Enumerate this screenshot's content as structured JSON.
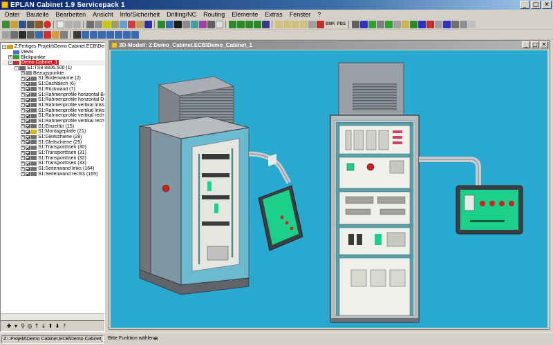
{
  "window": {
    "title": "EPLAN Cabinet 1.9 Servicepack 1",
    "min": "_",
    "max": "□",
    "close": "✕"
  },
  "menu": [
    "Datei",
    "Bauteile",
    "Bearbeiten",
    "Ansicht",
    "Info/Sicherheit",
    "Drilling/NC",
    "Routing",
    "Elemente",
    "Extras",
    "Fenster",
    "?"
  ],
  "toolbar": {
    "bmk_label": "BMK",
    "pbs_label": "PBS"
  },
  "tree": {
    "items": [
      {
        "indent": 0,
        "exp": "-",
        "label": "Z:Fertiges Projekt\\Demo Cabinet.ECB\\Demo_Cabinet_1",
        "icon": "project-icon",
        "color": "#d8a000"
      },
      {
        "indent": 1,
        "exp": "",
        "label": "Views",
        "icon": "views-icon",
        "color": "#5070c0"
      },
      {
        "indent": 1,
        "exp": "+",
        "label": "Blickpunkte",
        "icon": "viewpoint-icon",
        "color": "#30a030"
      },
      {
        "indent": 1,
        "exp": "-",
        "label": "Demo Cabinet_1",
        "icon": "cabinet-icon",
        "color": "#c03030",
        "selected": true
      },
      {
        "indent": 2,
        "exp": "-",
        "label": "S1:TS8 8806.500 (1)",
        "icon": "enclosure-icon",
        "color": "#606060"
      },
      {
        "indent": 3,
        "exp": "+",
        "label": "Bezugspunkte",
        "icon": "refpoint-icon",
        "color": "#909090",
        "nocheck": true
      },
      {
        "indent": 3,
        "exp": "+",
        "label": "S1:Bodenwanne (2)",
        "icon": "part-icon",
        "color": "#707070"
      },
      {
        "indent": 3,
        "exp": "+",
        "label": "S1:Dachblech (6)",
        "icon": "part-icon",
        "color": "#707070"
      },
      {
        "indent": 3,
        "exp": "+",
        "label": "S1:Rückwand (7)",
        "icon": "part-icon",
        "color": "#707070"
      },
      {
        "indent": 3,
        "exp": "+",
        "label": "S1:Rahmenprofile horizontal Bod",
        "icon": "profile-icon",
        "color": "#707070"
      },
      {
        "indent": 3,
        "exp": "+",
        "label": "S1:Rahmenprofile horizontal Dac",
        "icon": "profile-icon",
        "color": "#707070"
      },
      {
        "indent": 3,
        "exp": "+",
        "label": "S1:Rahmenprofile vertikal links v",
        "icon": "profile-icon",
        "color": "#707070"
      },
      {
        "indent": 3,
        "exp": "+",
        "label": "S1:Rahmenprofile vertikal links h",
        "icon": "profile-icon",
        "color": "#707070"
      },
      {
        "indent": 3,
        "exp": "+",
        "label": "S1:Rahmenprofile vertikal rechts",
        "icon": "profile-icon",
        "color": "#707070"
      },
      {
        "indent": 3,
        "exp": "+",
        "label": "S1:Rahmenprofile vertikal rechts",
        "icon": "profile-icon",
        "color": "#707070"
      },
      {
        "indent": 3,
        "exp": "+",
        "label": "S1:Einzeltür (15)",
        "icon": "door-icon",
        "color": "#707070"
      },
      {
        "indent": 3,
        "exp": "+",
        "label": "S1:Montageplatte (21)",
        "icon": "plate-icon",
        "color": "#e0b000"
      },
      {
        "indent": 3,
        "exp": "+",
        "label": "S1:Gleitschiene (28)",
        "icon": "rail-icon",
        "color": "#707070"
      },
      {
        "indent": 3,
        "exp": "+",
        "label": "S1:Gleitschiene (29)",
        "icon": "rail-icon",
        "color": "#707070"
      },
      {
        "indent": 3,
        "exp": "+",
        "label": "S1:Transportösen (30)",
        "icon": "eyelet-icon",
        "color": "#707070"
      },
      {
        "indent": 3,
        "exp": "+",
        "label": "S1:Transportösen (31)",
        "icon": "eyelet-icon",
        "color": "#707070"
      },
      {
        "indent": 3,
        "exp": "+",
        "label": "S1:Transportösen (32)",
        "icon": "eyelet-icon",
        "color": "#707070"
      },
      {
        "indent": 3,
        "exp": "+",
        "label": "S1:Transportösen (33)",
        "icon": "eyelet-icon",
        "color": "#707070"
      },
      {
        "indent": 3,
        "exp": "+",
        "label": "S1:Seitenwand links (164)",
        "icon": "sidewall-icon",
        "color": "#707070"
      },
      {
        "indent": 3,
        "exp": "+",
        "label": "S1:Seitenwand rechts (165)",
        "icon": "sidewall-icon",
        "color": "#707070"
      }
    ]
  },
  "view": {
    "title": "3D-Modell:  Z:Demo_Cabinet.ECB\\Demo_Cabinet_1",
    "background": "#29a9d0"
  },
  "status": {
    "path": "Z:..Projekt\\Demo Cabinet.ECB\\Demo Cabinet_1",
    "message": "Bitte Funktion wählen",
    "pin": "⊕"
  },
  "colors": {
    "titlebar": "#0a246a",
    "chrome": "#d4d0c8",
    "viewport": "#29a9d0",
    "panel_green": "#1bd08a"
  }
}
